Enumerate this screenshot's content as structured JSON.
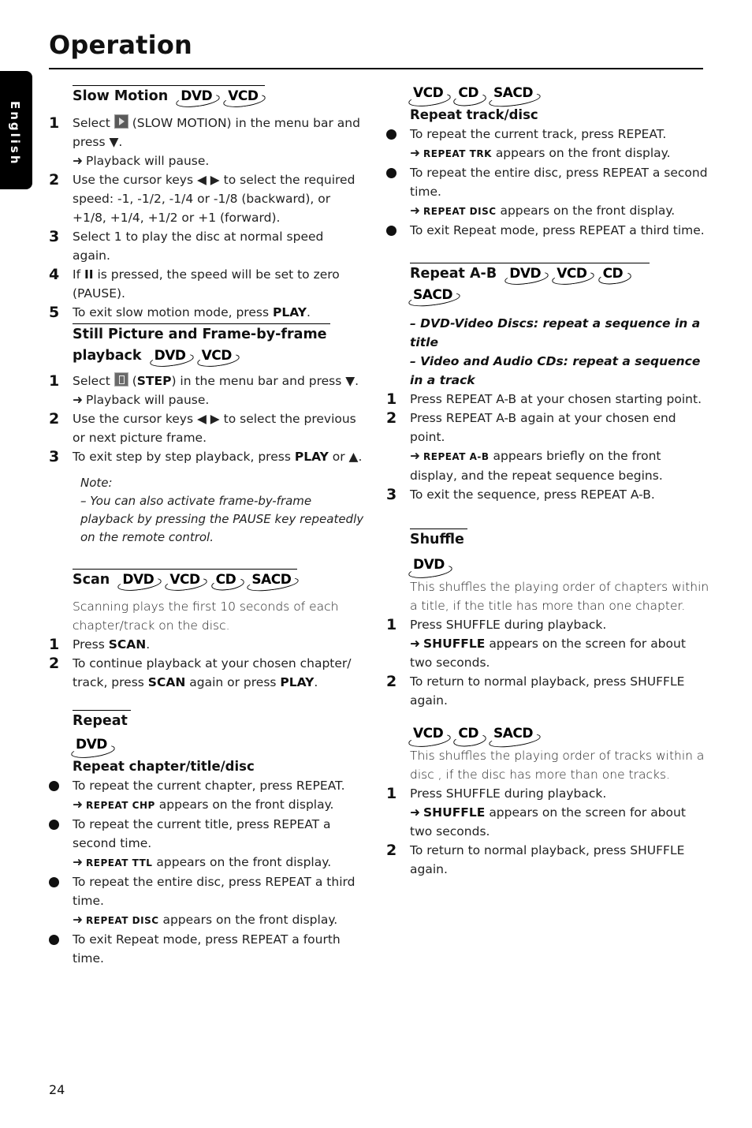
{
  "page_title": "Operation",
  "language_tab": "English",
  "page_number": "24",
  "glyphs": {
    "arrow": "➜",
    "down": "▼",
    "up": "▲",
    "left_right": "◀ ▶",
    "pause": "II"
  },
  "left": {
    "slow_motion": {
      "title": "Slow Motion",
      "discs": [
        "DVD",
        "VCD"
      ],
      "steps": [
        {
          "n": "1",
          "pre": "Select",
          "post": "(SLOW MOTION) in the menu bar and press ▼.",
          "result": "Playback will pause."
        },
        {
          "n": "2",
          "text": "Use the cursor keys ◀ ▶ to select the required speed: -1, -1/2, -1/4 or -1/8 (backward), or +1/8, +1/4, +1/2 or +1 (forward)."
        },
        {
          "n": "3",
          "text": "Select 1 to play the disc at normal speed again."
        },
        {
          "n": "4",
          "pre": "If",
          "post": "is pressed, the speed will be set to zero (PAUSE)."
        },
        {
          "n": "5",
          "pre": "To exit slow motion mode, press",
          "bold": "PLAY",
          "post": "."
        }
      ]
    },
    "still_picture": {
      "title_line1": "Still Picture and Frame-by-frame",
      "title_line2": "playback",
      "discs": [
        "DVD",
        "VCD"
      ],
      "steps": [
        {
          "n": "1",
          "pre": "Select",
          "bold": "STEP",
          "post": ") in the menu bar and press ▼.",
          "result": "Playback will pause."
        },
        {
          "n": "2",
          "text": "Use the cursor keys ◀ ▶ to select the previous or next picture frame."
        },
        {
          "n": "3",
          "pre": "To exit step by step playback, press",
          "bold": "PLAY",
          "post": "or ▲."
        }
      ],
      "note_label": "Note:",
      "note_text": "–   You can also activate frame-by-frame playback by pressing the PAUSE key repeatedly on the remote control."
    },
    "scan": {
      "title": "Scan",
      "discs": [
        "DVD",
        "VCD",
        "CD",
        "SACD"
      ],
      "intro": "Scanning plays the first 10 seconds of each chapter/track on the disc.",
      "steps": [
        {
          "n": "1",
          "pre": "Press",
          "bold": "SCAN",
          "post": "."
        },
        {
          "n": "2",
          "pre": "To continue playback at your chosen chapter/ track, press",
          "bold": "SCAN",
          "mid": "again or press",
          "bold2": "PLAY",
          "post": "."
        }
      ]
    },
    "repeat": {
      "title": "Repeat",
      "discs": [
        "DVD"
      ],
      "subtitle": "Repeat chapter/title/disc",
      "bullets": [
        {
          "text": "To repeat the current chapter, press REPEAT.",
          "display": "REPEAT CHP",
          "result": "appears on the front display."
        },
        {
          "text": "To repeat the current title, press REPEAT a second time.",
          "display": "REPEAT TTL",
          "result": "appears on the front display."
        },
        {
          "text": "To repeat the entire disc, press REPEAT a third time.",
          "display": "REPEAT DISC",
          "result": "appears on the front display."
        },
        {
          "text": "To exit Repeat mode, press REPEAT a fourth time."
        }
      ]
    }
  },
  "right": {
    "repeat_track": {
      "discs": [
        "VCD",
        "CD",
        "SACD"
      ],
      "subtitle": "Repeat track/disc",
      "bullets": [
        {
          "text": "To repeat the current track, press REPEAT.",
          "display": "REPEAT TRK",
          "result": "appears on the front display."
        },
        {
          "text": "To repeat the entire disc, press REPEAT a second time.",
          "display": "REPEAT DISC",
          "result": "appears on the front display."
        },
        {
          "text": "To exit Repeat mode, press REPEAT a third time."
        }
      ]
    },
    "repeat_ab": {
      "title": "Repeat A-B",
      "discs": [
        "DVD",
        "VCD",
        "CD",
        "SACD"
      ],
      "notes": [
        "–  DVD-Video Discs: repeat a sequence in a title",
        "–  Video and Audio CDs: repeat a sequence in a track"
      ],
      "steps": [
        {
          "n": "1",
          "text": "Press REPEAT A-B at your chosen starting point."
        },
        {
          "n": "2",
          "text": "Press REPEAT A-B again at your chosen end point.",
          "display": "REPEAT A-B",
          "result": "appears briefly on the front display, and the repeat sequence begins."
        },
        {
          "n": "3",
          "text": "To exit the sequence, press REPEAT A-B."
        }
      ]
    },
    "shuffle": {
      "title": "Shuffle",
      "dvd": {
        "discs": [
          "DVD"
        ],
        "intro": "This shuffles the playing order of chapters within a title, if the title has more than one chapter.",
        "steps": [
          {
            "n": "1",
            "text": "Press SHUFFLE during playback.",
            "display": "SHUFFLE",
            "result": "appears on the screen for about two seconds."
          },
          {
            "n": "2",
            "text": "To return to normal playback, press SHUFFLE again."
          }
        ]
      },
      "cd": {
        "discs": [
          "VCD",
          "CD",
          "SACD"
        ],
        "intro": "This shuffles the playing order of tracks within a disc , if the disc has more than one tracks.",
        "steps": [
          {
            "n": "1",
            "text": "Press SHUFFLE during playback.",
            "display": "SHUFFLE",
            "result": "appears on the screen for about two seconds."
          },
          {
            "n": "2",
            "text": "To return to normal playback, press SHUFFLE again."
          }
        ]
      }
    }
  }
}
